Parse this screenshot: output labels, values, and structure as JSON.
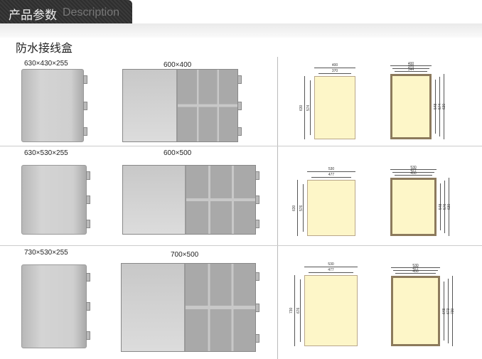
{
  "header": {
    "title_cn": "产品参数",
    "title_en": "Description"
  },
  "section_title": "防水接线盒",
  "rows": [
    {
      "size": "630×430×255",
      "inner": "600×400",
      "plan_left": {
        "w": "400",
        "w2": "370",
        "h": "630",
        "h2": "574"
      },
      "plan_right": {
        "w": "400",
        "w2": "370",
        "w3": "344",
        "h1": "548",
        "h2": "574",
        "h3": "630"
      }
    },
    {
      "size": "630×530×255",
      "inner": "600×500",
      "plan_left": {
        "w": "530",
        "w2": "477",
        "h": "630",
        "h2": "576"
      },
      "plan_right": {
        "w": "530",
        "w2": "477",
        "w3": "450",
        "h1": "548",
        "h2": "576",
        "h3": "630"
      }
    },
    {
      "size": "730×530×255",
      "inner": "700×500",
      "plan_left": {
        "w": "530",
        "w2": "477",
        "h": "730",
        "h2": "676"
      },
      "plan_right": {
        "w": "530",
        "w2": "477",
        "w3": "450",
        "h1": "648",
        "h2": "673",
        "h3": "730"
      }
    }
  ]
}
